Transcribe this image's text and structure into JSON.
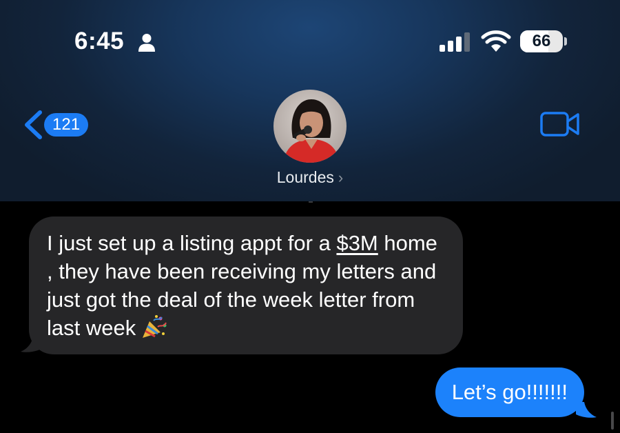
{
  "status_bar": {
    "time": "6:45",
    "battery_level": "66",
    "battery_fraction": 0.66,
    "icons": [
      "person-icon",
      "cellular-signal-icon",
      "wifi-icon",
      "battery-icon"
    ]
  },
  "nav": {
    "back_badge": "121",
    "contact_name": "Lourdes",
    "name_chevron": "›",
    "icons": [
      "back-chevron-icon",
      "video-call-icon"
    ]
  },
  "messages": [
    {
      "direction": "incoming",
      "text_before": "I just set up a listing appt for a ",
      "amount": "$3M",
      "text_after": " home , they have been receiving my letters and just got the deal of the week letter from last week",
      "emoji": "party-popper-icon"
    },
    {
      "direction": "outgoing",
      "text": "Let’s go!!!!!!!"
    }
  ],
  "colors": {
    "accent_blue": "#1c82fb",
    "incoming_bubble": "#262628",
    "header_top": "#1d4575",
    "background": "#000000"
  }
}
